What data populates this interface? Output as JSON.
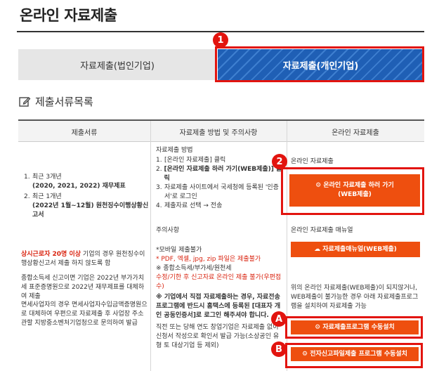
{
  "page_title": "온라인 자료제출",
  "tabs": [
    {
      "label": "자료제출(법인기업)"
    },
    {
      "label": "자료제출(개인기업)"
    }
  ],
  "badges": {
    "one": "1",
    "two": "2",
    "a": "A",
    "b": "B"
  },
  "section_title": "제출서류목록",
  "table": {
    "headers": [
      "제출서류",
      "자료제출 방법 및 주의사항",
      "온라인 자료제출"
    ],
    "documents": {
      "items": [
        {
          "num": "1.",
          "line1": "최근 3개년",
          "line2": "(2020, 2021, 2022) 재무제표"
        },
        {
          "num": "2.",
          "line1": "최근 1개년",
          "line2": "(2022년 1월~12월) 원천징수이행상황신고서"
        }
      ]
    },
    "doc_notes": {
      "p1_red": "상시근로자 20명 이상",
      "p1_rest": " 기업의 경우 원천징수이행상황신고서 제출 하지 않도록 함",
      "p2": "종합소득세 신고이면 기업은 2022년 부가가치세 표준증명원으로 2022년 재무제표를 대체하여 제출",
      "p3": "면세사업자의 경우 면세사업자수입금액증명원으로 대체하여 우편으로 자료제출 후 사업장 주소 관할 지방중소벤처기업청으로 문의하여 발급"
    },
    "method": {
      "heading": "자료제출 방법",
      "steps": [
        {
          "num": "1.",
          "text": "[온라인 자료제출] 클릭"
        },
        {
          "num": "2.",
          "text": "[온라인 자료제출 하러 가기(WEB제출)] 클릭"
        },
        {
          "num": "3.",
          "text": "자료제출 사이트에서 국세청에 등록된 '인증서'로 로그인"
        },
        {
          "num": "4.",
          "text": "제출자료 선택 → 전송"
        }
      ]
    },
    "cautions": {
      "heading": "주의사항",
      "mobile": "*모바일 제출불가",
      "formats_red": "* PDF, 엑셀, jpg, zip 파일은 제출불가",
      "tax_note": "※ 종합소득세/부가세/원천세",
      "tax_note2": "수정/기한 후 신고자료 온라인 제출 불가(우편접수)",
      "direct_note": "※ 기업에서 직접 자료제출하는 경우, 자료전송 프로그램에 반드시 홈택스에 등록된 [대표자 개인 공동인증서]로 로그인 해주셔야 합니다.",
      "startup_note": "직전 또는 당해 연도 창업기업은 자료제출 없이 신청서 작성으로 확인서 발급 가능(소상공인 유형 토 대상기업 등 제외)"
    },
    "online": {
      "label1": "온라인 자료제출",
      "btn_web": "⚙ 온라인 자료제출 하러 가기 (WEB제출)",
      "label2": "온라인 자료제출 매뉴얼",
      "btn_manual": "☁ 자료제출매뉴얼(WEB제출)",
      "fallback_note": "위의 온라인 자료제출(WEB제출)이 되지않거나, WEB제출이 불가능한 경우 아래 자료제출프로그램을 설치하여 자료제출 가능",
      "btn_program": "⚙ 자료제출프로그램 수동설치",
      "btn_efile": "⚙ 전자신고파일제출 프로그램 수동설치"
    }
  },
  "colors": {
    "accent_red": "#e2140f",
    "orange": "#ee4f0f",
    "tab_blue": "#1f5fb5"
  }
}
